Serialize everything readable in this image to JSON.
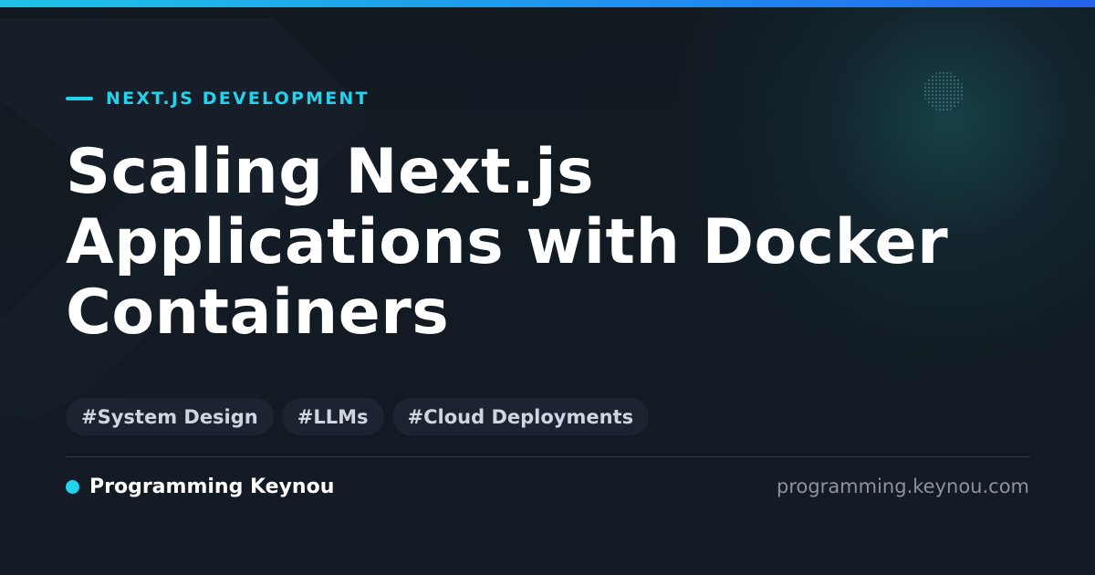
{
  "header": {
    "eyebrow": "NEXT.JS DEVELOPMENT",
    "title": "Scaling Next.js Applications with Docker Containers"
  },
  "tags": [
    "#System Design",
    "#LLMs",
    "#Cloud Deployments"
  ],
  "footer": {
    "brand": "Programming Keynou",
    "url": "programming.keynou.com"
  },
  "colors": {
    "accent": "#22d3ee",
    "background": "#111822",
    "tag_background": "#1b2430",
    "title": "#ffffff",
    "url": "#8a93a0"
  },
  "icons": {
    "background": "nextjs-logo-watermark",
    "brand": "dot-icon"
  }
}
